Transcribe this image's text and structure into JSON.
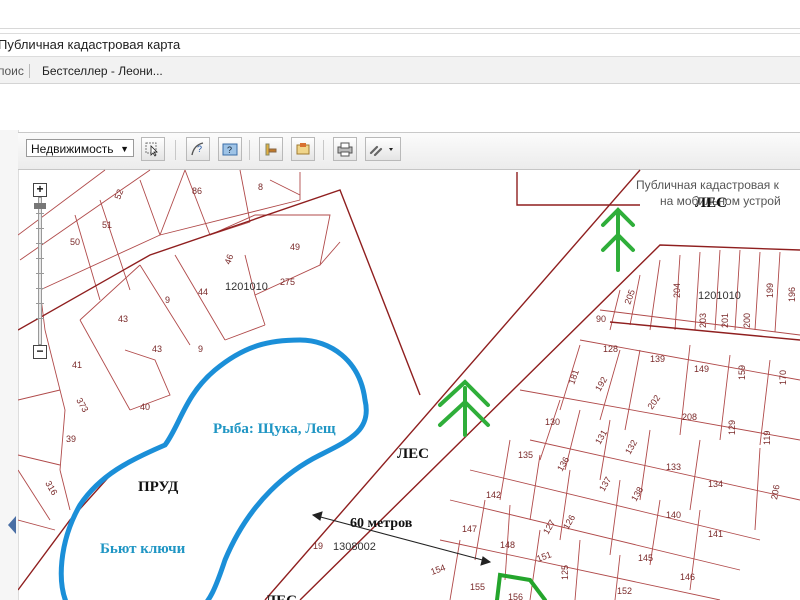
{
  "browser": {
    "address": "Публичная кадастровая карта",
    "favorites": [
      "поис",
      "Бестселлер - Леони..."
    ]
  },
  "banner": {
    "line1": "Публичная кадастровая к",
    "line2": "на мобильном устрой"
  },
  "toolbar": {
    "layer_select": "Недвижимость",
    "buttons": [
      "select-icon",
      "identify-icon",
      "info-icon",
      "measure-icon",
      "bookmark-icon",
      "print-icon",
      "link-icon"
    ]
  },
  "map": {
    "quarters": [
      "1201010",
      "1201010",
      "1308002"
    ],
    "parcels_left": [
      "52",
      "86",
      "8",
      "51",
      "50",
      "49",
      "46",
      "275",
      "44",
      "9",
      "43",
      "43",
      "9",
      "41",
      "373",
      "40",
      "39",
      "316",
      "19"
    ],
    "parcels_right": [
      "205",
      "204",
      "199",
      "196",
      "203",
      "201",
      "200",
      "90",
      "128",
      "139",
      "149",
      "159",
      "170",
      "181",
      "192",
      "202",
      "208",
      "129",
      "119",
      "130",
      "131",
      "132",
      "133",
      "134",
      "135",
      "136",
      "137",
      "138",
      "206",
      "142",
      "140",
      "141",
      "147",
      "148",
      "126",
      "127",
      "151",
      "146",
      "154",
      "155",
      "125",
      "152",
      "145",
      "156"
    ],
    "labels": {
      "forest": "ЛЕС",
      "pond": "ПРУД",
      "fish": "Рыба: Щука, Лещ",
      "springs": "Бьют ключи",
      "distance": "60 метров"
    },
    "colors": {
      "parcel": "#b04a4a",
      "boundary": "#8f1f1f",
      "pond": "#1b8fd8",
      "text_blue": "#2096c4",
      "tree": "#2fae3a",
      "plot": "#24a52c"
    }
  }
}
